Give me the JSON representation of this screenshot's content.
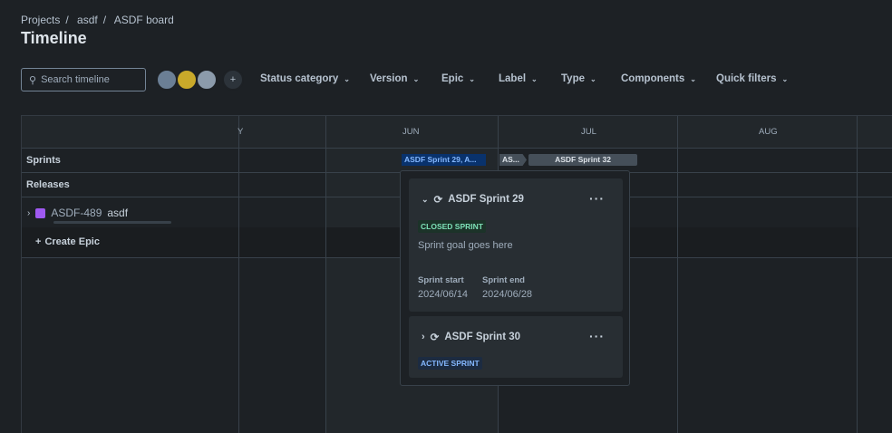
{
  "breadcrumb": [
    "Projects",
    "asdf",
    "ASDF board"
  ],
  "title": "Timeline",
  "search": {
    "placeholder": "Search timeline"
  },
  "filters": [
    "Status category",
    "Version",
    "Epic",
    "Label",
    "Type",
    "Components",
    "Quick filters"
  ],
  "months": [
    "Y",
    "JUN",
    "JUL",
    "AUG"
  ],
  "rows": {
    "sprints": "Sprints",
    "releases": "Releases",
    "create_epic": "Create Epic"
  },
  "epic": {
    "key": "ASDF-489",
    "summary": "asdf"
  },
  "sprint_bars": {
    "a": "ASDF Sprint 29, A...",
    "b": "AS...",
    "c": "ASDF Sprint 32"
  },
  "popup": {
    "sprints": [
      {
        "name": "ASDF Sprint 29",
        "status": "CLOSED SPRINT",
        "goal": "Sprint goal goes here",
        "start_label": "Sprint start",
        "start": "2024/06/14",
        "end_label": "Sprint end",
        "end": "2024/06/28"
      },
      {
        "name": "ASDF Sprint 30",
        "status": "ACTIVE SPRINT"
      }
    ]
  },
  "colors": {
    "closed": "#7ee2b8",
    "active": "#85b8ff",
    "epic": "#9f59f1"
  }
}
